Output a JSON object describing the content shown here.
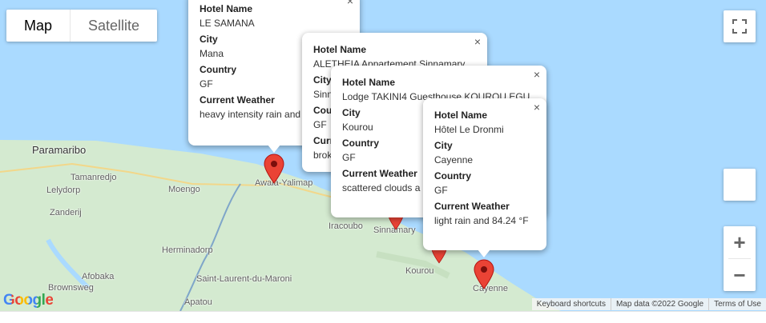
{
  "map_type": {
    "map": "Map",
    "satellite": "Satellite"
  },
  "places": {
    "paramaribo": "Paramaribo",
    "tamanredjo": "Tamanredjo",
    "lelydorp": "Lelydorp",
    "zanderij": "Zanderij",
    "moengo": "Moengo",
    "awala": "Awala-Yalimap",
    "iracoubo": "Iracoubo",
    "sinnamary": "Sinnamary",
    "kourou": "Kourou",
    "cayenne": "Cayenne",
    "herminadorp": "Herminadorp",
    "afobaka": "Afobaka",
    "brownsweg": "Brownsweg",
    "saint_laurent": "Saint-Laurent-du-Maroni",
    "apatou": "Apatou"
  },
  "popups": [
    {
      "hotel_label": "Hotel Name",
      "hotel": "LE SAMANA",
      "city_label": "City",
      "city": "Mana",
      "country_label": "Country",
      "country": "GF",
      "weather_label": "Current Weather",
      "weather": "heavy intensity rain and"
    },
    {
      "hotel_label": "Hotel Name",
      "hotel": "ALETHEIA Appartement Sinnamary",
      "city_label": "City",
      "city": "Sinn",
      "country_label": "Cou",
      "country": "GF",
      "weather_label": "Curr",
      "weather": "brok"
    },
    {
      "hotel_label": "Hotel Name",
      "hotel": "Lodge TAKINI4 Guesthouse KOUROU EGU",
      "city_label": "City",
      "city": "Kourou",
      "country_label": "Country",
      "country": "GF",
      "weather_label": "Current Weather",
      "weather": "scattered clouds a"
    },
    {
      "hotel_label": "Hotel Name",
      "hotel": "Hôtel Le Dronmi",
      "city_label": "City",
      "city": "Cayenne",
      "country_label": "Country",
      "country": "GF",
      "weather_label": "Current Weather",
      "weather": "light rain and 84.24 °F"
    }
  ],
  "close_glyph": "×",
  "google_logo": "Google",
  "footer": {
    "shortcuts": "Keyboard shortcuts",
    "data": "Map data ©2022 Google",
    "terms": "Terms of Use"
  },
  "zoom": {
    "in": "+",
    "out": "−"
  },
  "colors": {
    "water": "#aadaff",
    "land": "#d4ead0",
    "marker": "#ea4335"
  }
}
